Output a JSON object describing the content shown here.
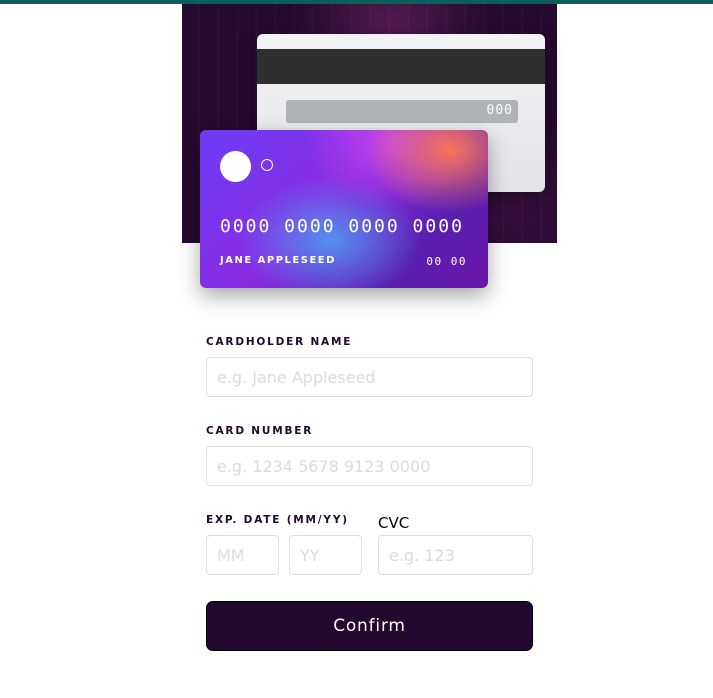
{
  "card_preview": {
    "number": "0000 0000 0000 0000",
    "name": "JANE APPLESEED",
    "exp": "00 00",
    "cvc": "000"
  },
  "form": {
    "cardholder_label": "CARDHOLDER NAME",
    "cardholder_placeholder": "e.g. Jane Appleseed",
    "number_label": "CARD NUMBER",
    "number_placeholder": "e.g. 1234 5678 9123 0000",
    "exp_label": "EXP. DATE (MM/YY)",
    "month_placeholder": "MM",
    "year_placeholder": "YY",
    "cvc_label": "CVC",
    "cvc_placeholder": "e.g. 123",
    "confirm_label": "Confirm"
  },
  "colors": {
    "dark_violet": "#21092f",
    "top_accent": "#0f5e5e",
    "input_border": "#dedddf",
    "placeholder": "#dcdcdf"
  }
}
